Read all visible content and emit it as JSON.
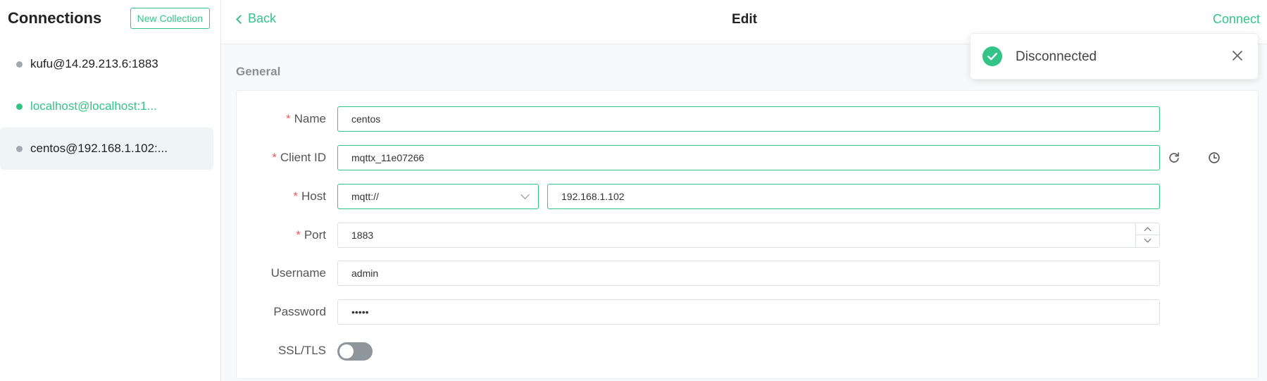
{
  "sidebar": {
    "title": "Connections",
    "new_collection_label": "New Collection",
    "connections": [
      {
        "label": "kufu@14.29.213.6:1883",
        "status": "offline"
      },
      {
        "label": "localhost@localhost:1...",
        "status": "online"
      },
      {
        "label": "centos@192.168.1.102:...",
        "status": "offline",
        "selected": true
      }
    ]
  },
  "topbar": {
    "back_label": "Back",
    "title": "Edit",
    "connect_label": "Connect"
  },
  "section": {
    "general_title": "General"
  },
  "form": {
    "name": {
      "label": "Name",
      "value": "centos",
      "required": true
    },
    "client_id": {
      "label": "Client ID",
      "value": "mqttx_11e07266",
      "required": true
    },
    "host": {
      "label": "Host",
      "protocol": "mqtt://",
      "value": "192.168.1.102",
      "required": true
    },
    "port": {
      "label": "Port",
      "value": "1883",
      "required": true
    },
    "username": {
      "label": "Username",
      "value": "admin"
    },
    "password": {
      "label": "Password",
      "value": "•••••"
    },
    "ssl": {
      "label": "SSL/TLS",
      "enabled": false
    }
  },
  "toast": {
    "message": "Disconnected",
    "icon": "check-circle-icon"
  },
  "colors": {
    "accent": "#34c388",
    "required": "#f15b5b",
    "toggle_off": "#8e959b"
  }
}
